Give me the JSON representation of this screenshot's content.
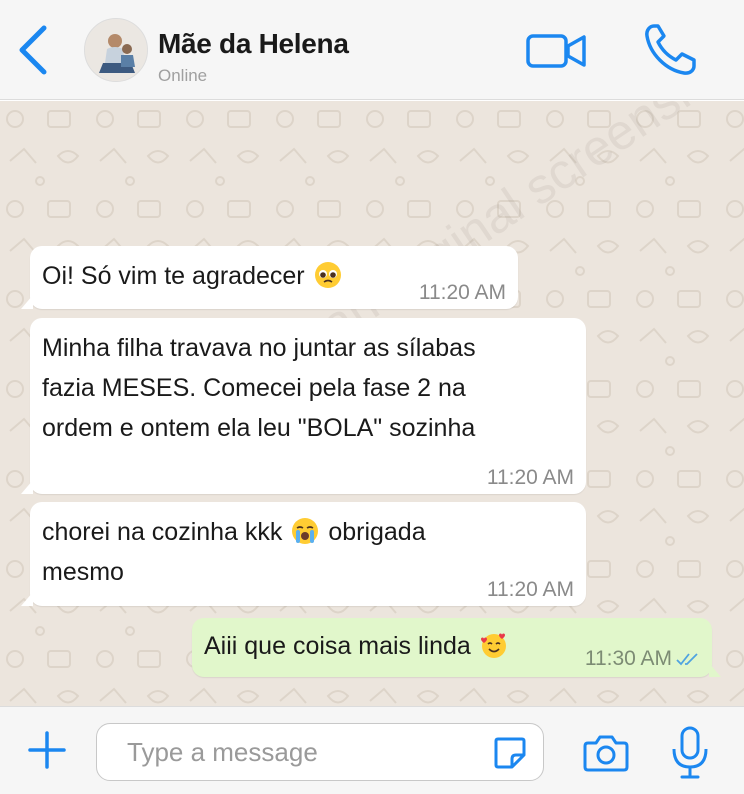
{
  "header": {
    "contact_name": "Mãe da Helena",
    "status": "Online",
    "back_icon": "chevron-left-icon",
    "video_icon": "video-camera-icon",
    "call_icon": "phone-icon"
  },
  "watermark": "This is not an original screenshot!!!",
  "messages": [
    {
      "direction": "incoming",
      "text": "Oi! Só vim te agradecer",
      "emoji": "pleading-face",
      "time": "11:20 AM"
    },
    {
      "direction": "incoming",
      "lines": [
        "Minha filha travava no juntar as sílabas",
        "fazia MESES. Comecei pela fase 2 na",
        "ordem e ontem ela leu \"BOLA\" sozinha"
      ],
      "time": "11:20 AM"
    },
    {
      "direction": "incoming",
      "text_before": "chorei na cozinha kkk",
      "emoji": "loudly-crying-face",
      "text_after": "obrigada",
      "line2": "mesmo",
      "time": "11:20 AM"
    },
    {
      "direction": "outgoing",
      "text": "Aiii que coisa mais linda",
      "emoji": "smiling-face-with-hearts",
      "time": "11:30 AM",
      "status": "read"
    }
  ],
  "footer": {
    "placeholder": "Type a message",
    "value": "",
    "plus_icon": "plus-icon",
    "sticker_icon": "sticker-icon",
    "camera_icon": "camera-icon",
    "mic_icon": "microphone-icon"
  },
  "colors": {
    "accent": "#1b87f0",
    "chat_background": "#ece5dd",
    "incoming_bubble": "#ffffff",
    "outgoing_bubble": "#e1f7cb",
    "read_ticks": "#4fa3e0"
  }
}
